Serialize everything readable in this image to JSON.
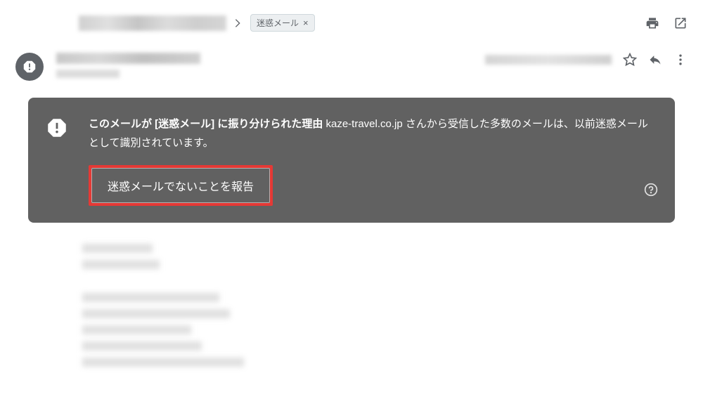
{
  "header": {
    "label_chip": "迷惑メール"
  },
  "spam_banner": {
    "reason_bold": "このメールが [迷惑メール] に振り分けられた理由",
    "reason_domain": "kaze-travel.co.jp さんから受信した多数のメールは、以前迷惑メールとして識別されています。",
    "not_spam_button": "迷惑メールでないことを報告"
  }
}
